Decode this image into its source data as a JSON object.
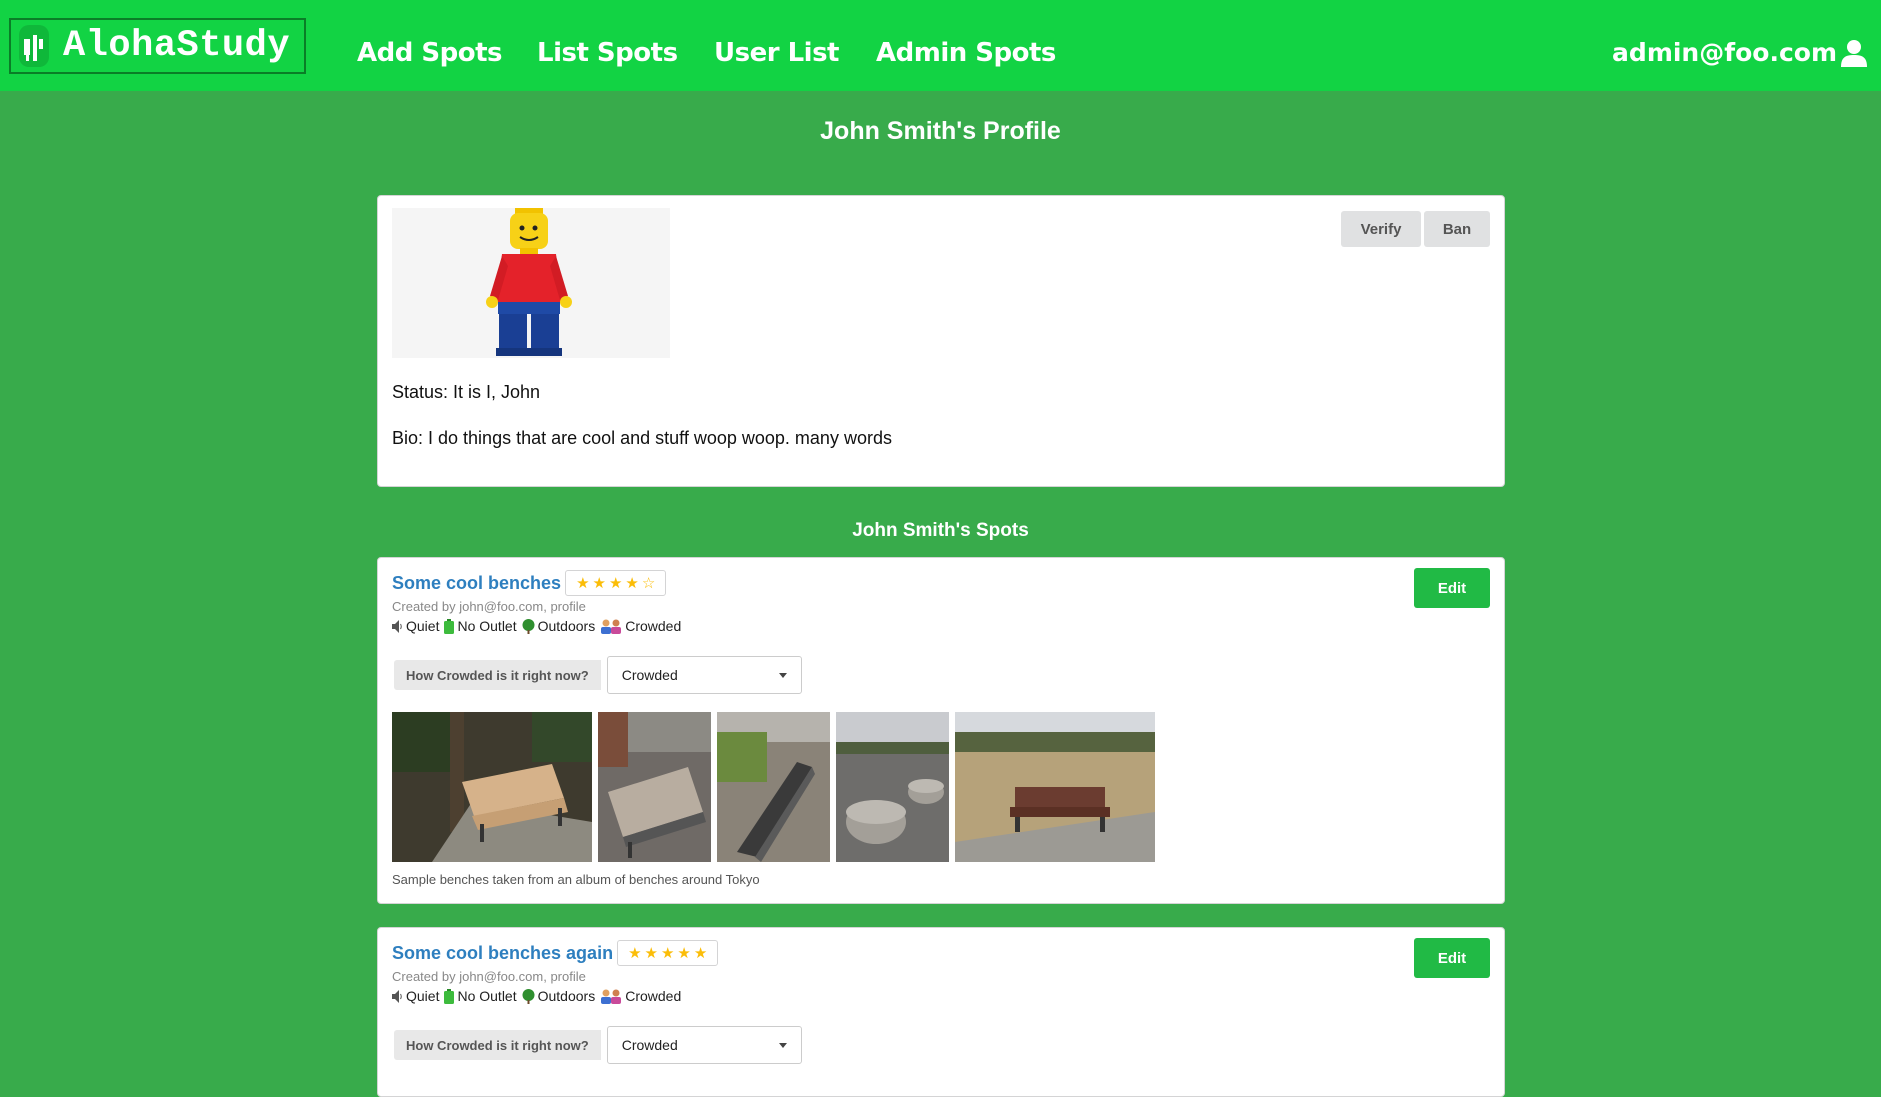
{
  "navbar": {
    "brand": "AlohaStudy",
    "items": [
      {
        "label": "Add Spots"
      },
      {
        "label": "List Spots"
      },
      {
        "label": "User List"
      },
      {
        "label": "Admin Spots"
      }
    ],
    "user": "admin@foo.com"
  },
  "page_title": "John Smith's Profile",
  "profile": {
    "verify_label": "Verify",
    "ban_label": "Ban",
    "status": "Status: It is I, John",
    "bio": "Bio: I do things that are cool and stuff woop woop. many words"
  },
  "spots_title": "John Smith's Spots",
  "spots": [
    {
      "title": "Some cool benches",
      "rating": 4,
      "created_by": "Created by john@foo.com, profile",
      "tags": [
        "Quiet",
        "No Outlet",
        "Outdoors",
        "Crowded"
      ],
      "edit_label": "Edit",
      "crowd_question": "How Crowded is it right now?",
      "crowd_value": "Crowded",
      "caption": "Sample benches taken from an album of benches around Tokyo"
    },
    {
      "title": "Some cool benches again",
      "rating": 5,
      "created_by": "Created by john@foo.com, profile",
      "tags": [
        "Quiet",
        "No Outlet",
        "Outdoors",
        "Crowded"
      ],
      "edit_label": "Edit",
      "crowd_question": "How Crowded is it right now?",
      "crowd_value": "Crowded"
    }
  ],
  "colors": {
    "navbar": "#12d344",
    "background": "#38ab4b",
    "link": "#2e7fbf",
    "edit_button": "#21ba45",
    "star": "#fbbd08"
  }
}
